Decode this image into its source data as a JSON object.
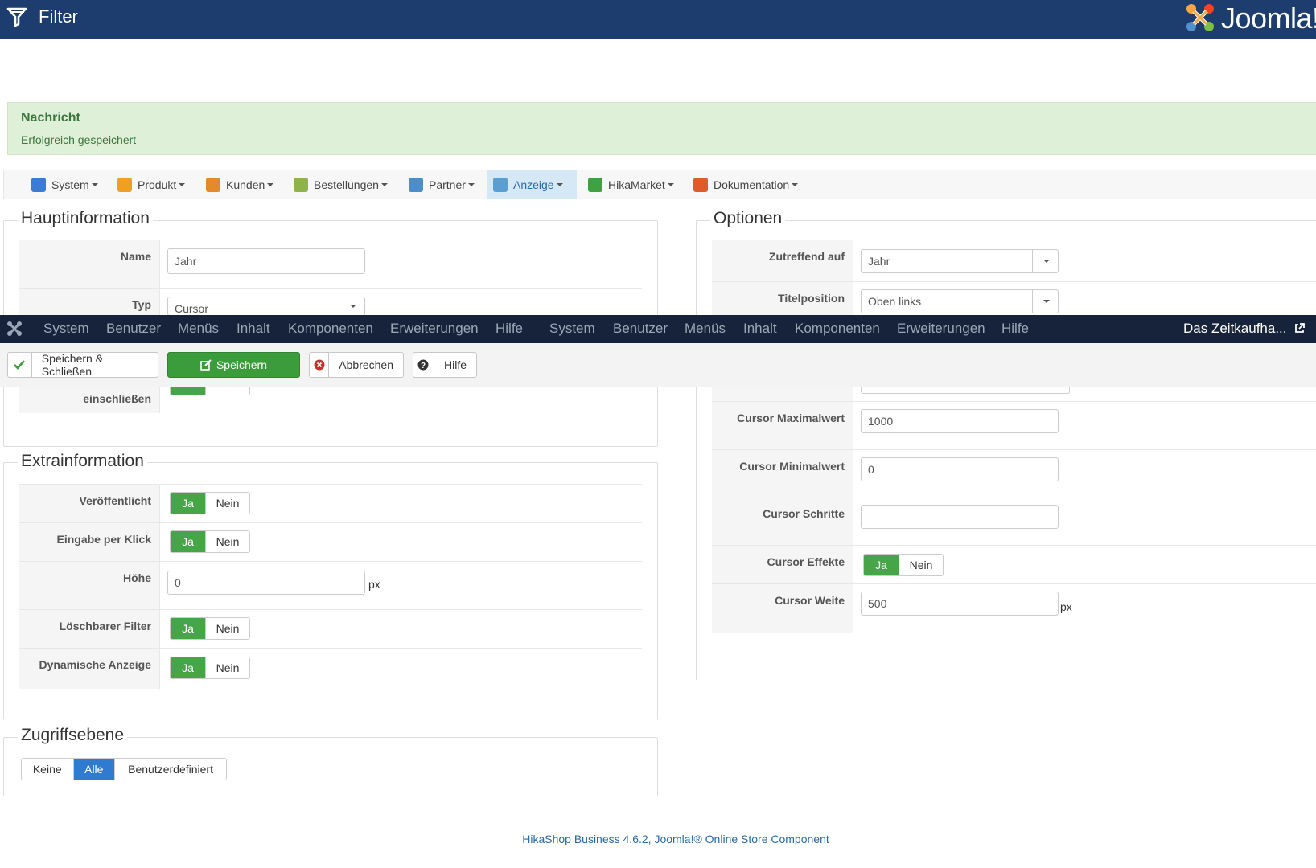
{
  "header": {
    "title": "Filter",
    "brand": "Joomla!"
  },
  "message": {
    "heading": "Nachricht",
    "text": "Erfolgreich gespeichert"
  },
  "hika_menu": [
    {
      "label": "System",
      "color": "#3a7bd5"
    },
    {
      "label": "Produkt",
      "color": "#f0a020"
    },
    {
      "label": "Kunden",
      "color": "#e38a2b"
    },
    {
      "label": "Bestellungen",
      "color": "#8fb34a"
    },
    {
      "label": "Partner",
      "color": "#4c8ec9"
    },
    {
      "label": "Anzeige",
      "color": "#5a9fd4",
      "active": true
    },
    {
      "label": "HikaMarket",
      "color": "#3fa13f"
    },
    {
      "label": "Dokumentation",
      "color": "#e05a2a"
    }
  ],
  "main_info": {
    "legend": "Hauptinformation",
    "name_label": "Name",
    "name_value": "Jahr",
    "type_label": "Typ",
    "type_value": "Cursor",
    "partial_label": "einschließen",
    "toggle_on": "Ja",
    "toggle_off": "Nein"
  },
  "extra_info": {
    "legend": "Extrainformation",
    "rows": [
      {
        "label": "Veröffentlicht",
        "on": "Ja",
        "off": "Nein"
      },
      {
        "label": "Eingabe per Klick",
        "on": "Ja",
        "off": "Nein"
      },
      {
        "label": "Höhe",
        "value": "0",
        "unit": "px"
      },
      {
        "label": "Löschbarer Filter",
        "on": "Ja",
        "off": "Nein"
      },
      {
        "label": "Dynamische Anzeige",
        "on": "Ja",
        "off": "Nein"
      }
    ]
  },
  "access": {
    "legend": "Zugriffsebene",
    "options": [
      "Keine",
      "Alle",
      "Benutzerdefiniert"
    ],
    "selected": "Alle"
  },
  "options": {
    "legend": "Optionen",
    "applies_label": "Zutreffend auf",
    "applies_value": "Jahr",
    "titlepos_label": "Titelposition",
    "titlepos_value": "Oben links",
    "max_label": "Cursor Maximalwert",
    "max_value": "1000",
    "min_label": "Cursor Minimalwert",
    "min_value": "0",
    "step_label": "Cursor Schritte",
    "step_value": "",
    "effects_label": "Cursor Effekte",
    "effects_on": "Ja",
    "effects_off": "Nein",
    "width_label": "Cursor Weite",
    "width_value": "500",
    "width_unit": "px"
  },
  "joomla_bar": {
    "items": [
      "System",
      "Benutzer",
      "Menüs",
      "Inhalt",
      "Komponenten",
      "Erweiterungen",
      "Hilfe",
      "System",
      "Benutzer",
      "Menüs",
      "Inhalt",
      "Komponenten",
      "Erweiterungen",
      "Hilfe"
    ],
    "site": "Das Zeitkaufha..."
  },
  "toolbar": {
    "save_close": "Speichern & Schließen",
    "save": "Speichern",
    "cancel": "Abbrechen",
    "help": "Hilfe"
  },
  "footer": {
    "text": "HikaShop Business 4.6.2, Joomla!® Online Store Component"
  }
}
